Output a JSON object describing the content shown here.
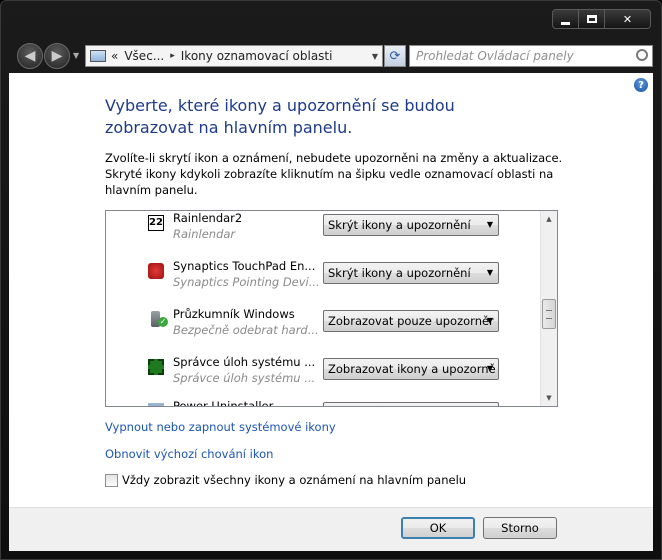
{
  "breadcrumb": {
    "prefix": "«",
    "item1": "Všec...",
    "separator": "▸",
    "item2": "Ikony oznamovací oblasti"
  },
  "search": {
    "placeholder": "Prohledat Ovládací panely"
  },
  "help_label": "?",
  "heading": "Vyberte, které ikony a upozornění se budou zobrazovat na hlavním panelu.",
  "description": "Zvolíte-li skrytí ikon a oznámení, nebudete upozorněni na změny a aktualizace. Skryté ikony kdykoli zobrazíte kliknutím na šipku vedle oznamovací oblasti na hlavním panelu.",
  "items": [
    {
      "icon": "calendar-22-icon",
      "icon_text": "22",
      "name": "Rainlendar2",
      "subtitle": "Rainlendar",
      "behavior": "Skrýt ikony a upozornění"
    },
    {
      "icon": "synaptics-icon",
      "name": "Synaptics TouchPad En...",
      "subtitle": "Synaptics Pointing Devi...",
      "behavior": "Skrýt ikony a upozornění"
    },
    {
      "icon": "usb-safely-remove-icon",
      "name": "Průzkumník Windows",
      "subtitle": "Bezpečně odebrat hard...",
      "behavior": "Zobrazovat pouze upozorněr"
    },
    {
      "icon": "task-manager-icon",
      "name": "Správce úloh systému ...",
      "subtitle": "Správce úloh systému ...",
      "behavior": "Zobrazovat ikony a upozorně"
    },
    {
      "icon": "partial-item-icon",
      "name": "Power Uninstaller",
      "subtitle": "",
      "behavior": ""
    }
  ],
  "links": {
    "system_icons": "Vypnout nebo zapnout systémové ikony",
    "restore_default": "Obnovit výchozí chování ikon"
  },
  "always_show": {
    "label": "Vždy zobrazit všechny ikony a oznámení na hlavním panelu",
    "checked": false
  },
  "buttons": {
    "ok": "OK",
    "cancel": "Storno"
  },
  "colors": {
    "heading": "#1e3b8a",
    "link": "#1b55b4",
    "frame": "#0e0e0e"
  }
}
